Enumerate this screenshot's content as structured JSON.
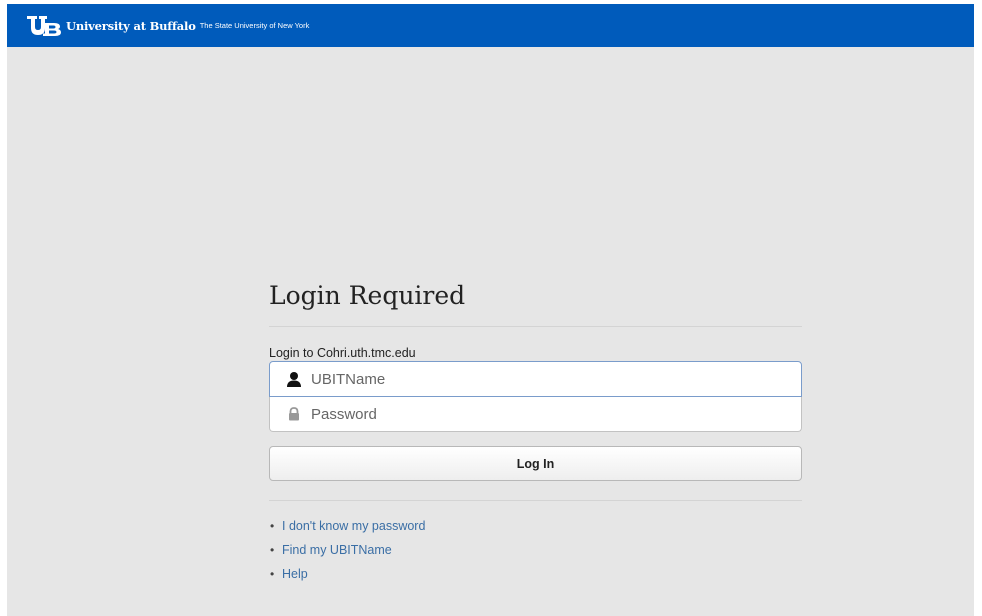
{
  "header": {
    "logo_text": "UB",
    "brand": "University at Buffalo",
    "tagline": "The State University of New York",
    "background_color": "#005bbb"
  },
  "login": {
    "title": "Login Required",
    "subtitle": "Login to Cohri.uth.tmc.edu",
    "username": {
      "placeholder": "UBITName",
      "value": "",
      "icon": "user-icon"
    },
    "password": {
      "placeholder": "Password",
      "value": "",
      "icon": "lock-icon"
    },
    "submit_label": "Log In"
  },
  "links": [
    {
      "label": "I don't know my password"
    },
    {
      "label": "Find my UBITName"
    },
    {
      "label": "Help"
    }
  ],
  "colors": {
    "page_background": "#e6e6e6",
    "link": "#3a6ea5"
  }
}
